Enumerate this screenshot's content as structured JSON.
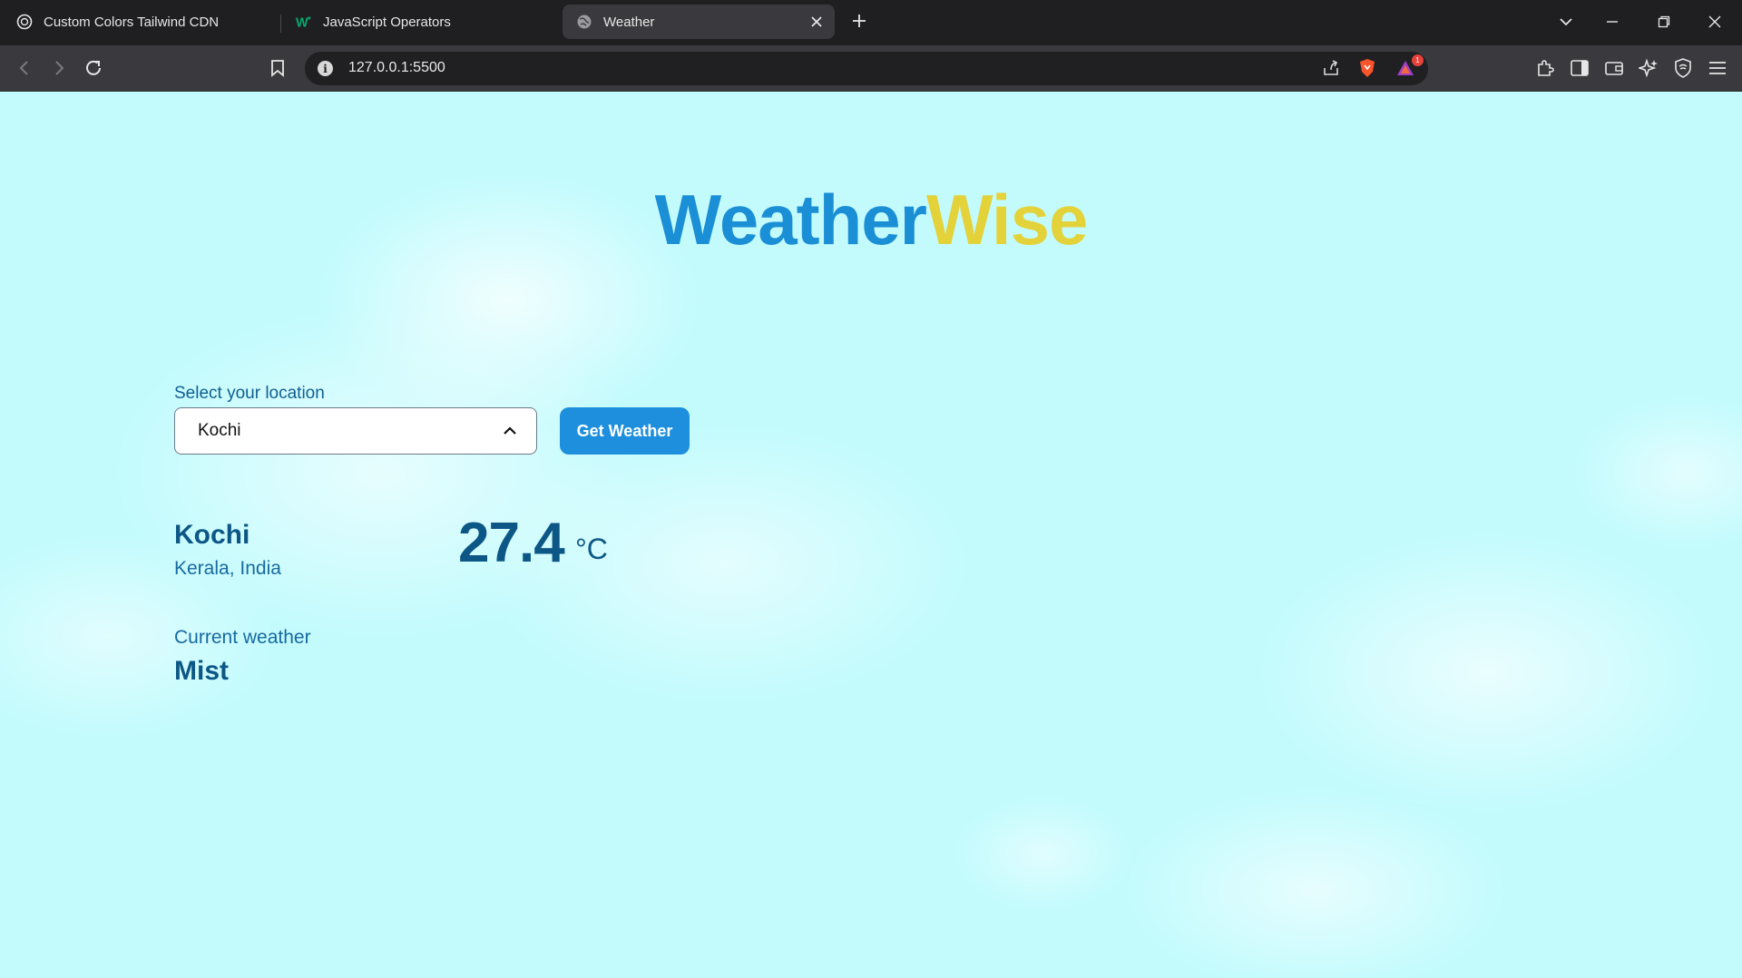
{
  "browser": {
    "tabs": [
      {
        "title": "Custom Colors Tailwind CDN",
        "icon": "openai-icon"
      },
      {
        "title": "JavaScript Operators",
        "icon": "w3-icon"
      },
      {
        "title": "Weather",
        "icon": "globe-icon"
      }
    ],
    "address": "127.0.0.1:5500",
    "notification_count": "1"
  },
  "page": {
    "brand_part1": "Weather",
    "brand_part2": "Wise",
    "brand_colors": {
      "part1": "#1b8fd6",
      "part2": "#e4d23a"
    },
    "location_label": "Select your location",
    "selected_location": "Kochi",
    "button_label": "Get Weather",
    "button_color": "#1d8fdc",
    "city": "Kochi",
    "region": "Kerala, India",
    "temperature": "27.4",
    "unit": "°C",
    "current_weather_label": "Current weather",
    "current_weather": "Mist",
    "background_color": "#c3fbfd"
  }
}
